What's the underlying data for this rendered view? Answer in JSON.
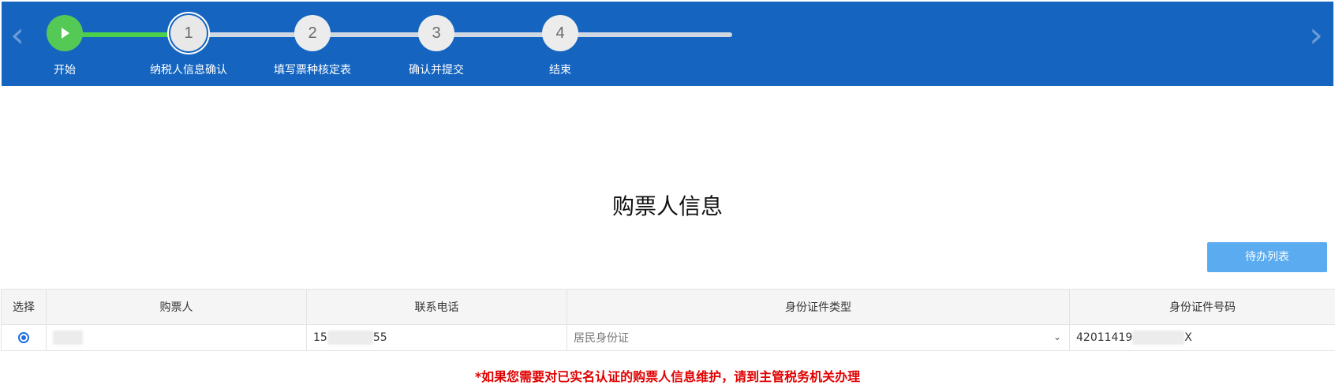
{
  "steps": [
    {
      "number": "",
      "label": "开始",
      "state": "start",
      "icon": "play-icon"
    },
    {
      "number": "1",
      "label": "纳税人信息确认",
      "state": "current"
    },
    {
      "number": "2",
      "label": "填写票种核定表",
      "state": "pending"
    },
    {
      "number": "3",
      "label": "确认并提交",
      "state": "pending"
    },
    {
      "number": "4",
      "label": "结束",
      "state": "pending"
    }
  ],
  "nav": {
    "prev_icon": "‹",
    "next_icon": "›"
  },
  "section_title": "购票人信息",
  "todo_button": "待办列表",
  "table": {
    "headers": {
      "select": "选择",
      "buyer": "购票人",
      "phone": "联系电话",
      "id_type": "身份证件类型",
      "id_number": "身份证件号码"
    },
    "row": {
      "selected": true,
      "phone_prefix": "15",
      "phone_suffix": "55",
      "id_type": "居民身份证",
      "id_number_prefix": "42011419",
      "id_number_suffix": "X"
    }
  },
  "notice": "*如果您需要对已实名认证的购票人信息维护，请到主管税务机关办理",
  "colors": {
    "header_bg": "#1565c0",
    "progress_green": "#4cd04c",
    "button_bg": "#5aabf0",
    "notice_red": "#e00000",
    "radio_blue": "#1f6fe0"
  }
}
